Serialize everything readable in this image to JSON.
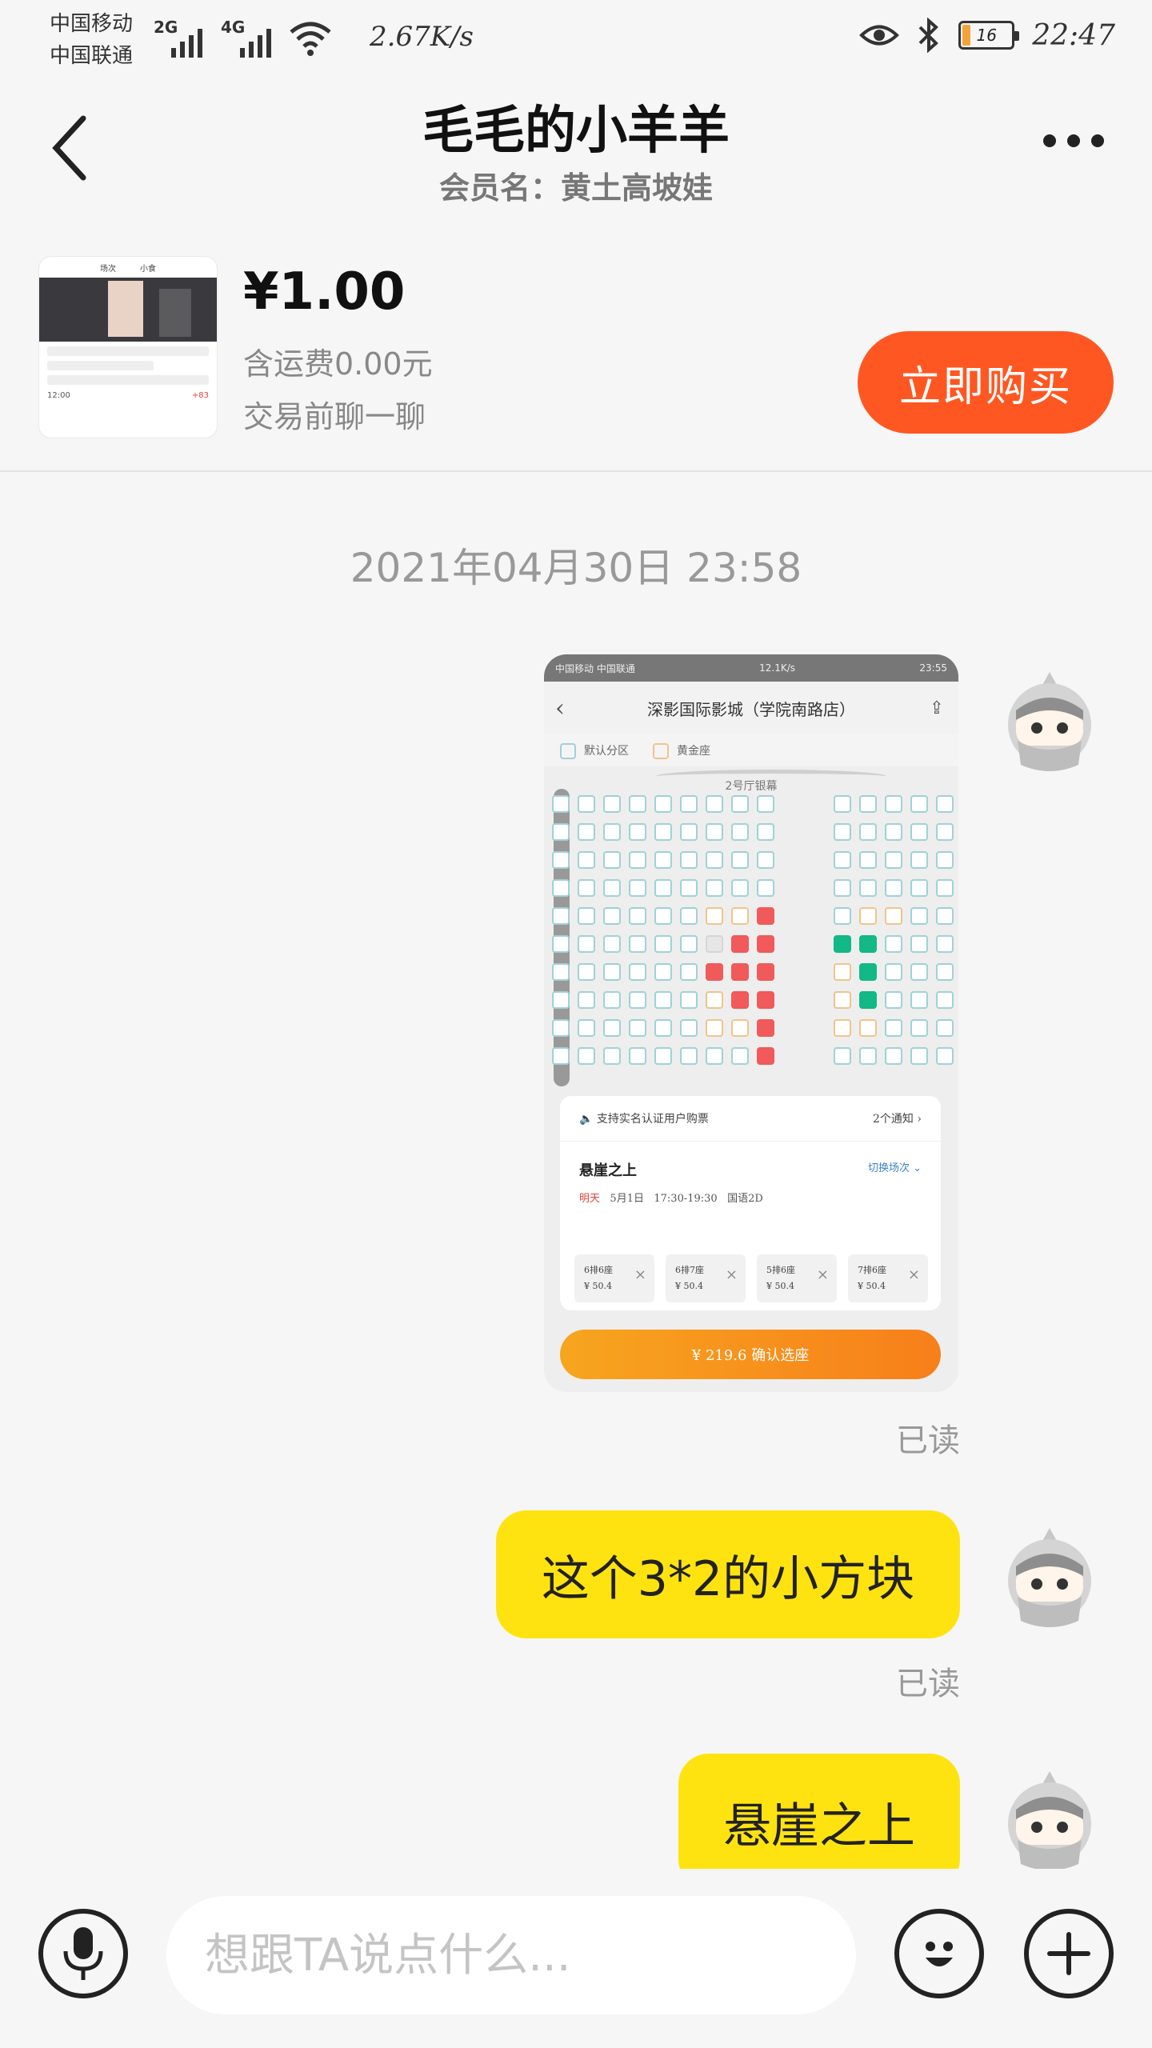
{
  "status_bar": {
    "carrier_1": "中国移动",
    "carrier_2": "中国联通",
    "net_1": "2G",
    "net_2": "4G",
    "speed": "2.67K/s",
    "battery": "16",
    "time": "22:47"
  },
  "header": {
    "title": "毛毛的小羊羊",
    "subtitle": "会员名：黄土高坡娃"
  },
  "product": {
    "price": "¥1.00",
    "shipping": "含运费0.00元",
    "chat_first": "交易前聊一聊",
    "buy_label": "立即购买",
    "thumb_tab_1": "场次",
    "thumb_tab_2": "小食",
    "thumb_time": "12:00",
    "thumb_price": "+83"
  },
  "chat": {
    "timestamp": "2021年04月30日 23:58",
    "read_label": "已读",
    "message_1": "这个3*2的小方块",
    "message_2": "悬崖之上"
  },
  "shared_screenshot": {
    "status_left": "中国移动 中国联通",
    "status_speed": "12.1K/s",
    "status_time": "23:55",
    "cinema": "深影国际影城（学院南路店）",
    "legend_default": "默认分区",
    "legend_gold": "黄金座",
    "hall": "2号厅银幕",
    "notice": "支持实名认证用户购票",
    "notice_count": "2个通知",
    "movie": "悬崖之上",
    "switch": "切换场次",
    "day": "明天",
    "date": "5月1日",
    "time": "17:30-19:30",
    "format": "国语2D",
    "tickets": [
      {
        "seat": "6排6座",
        "price": "¥ 50.4"
      },
      {
        "seat": "6排7座",
        "price": "¥ 50.4"
      },
      {
        "seat": "5排6座",
        "price": "¥ 50.4"
      },
      {
        "seat": "7排6座",
        "price": "¥ 50.4"
      }
    ],
    "confirm": "¥ 219.6  确认选座"
  },
  "input": {
    "placeholder": "想跟TA说点什么..."
  },
  "icons": [
    "back-icon",
    "more-icon",
    "voice-icon",
    "emoji-icon",
    "plus-icon"
  ]
}
